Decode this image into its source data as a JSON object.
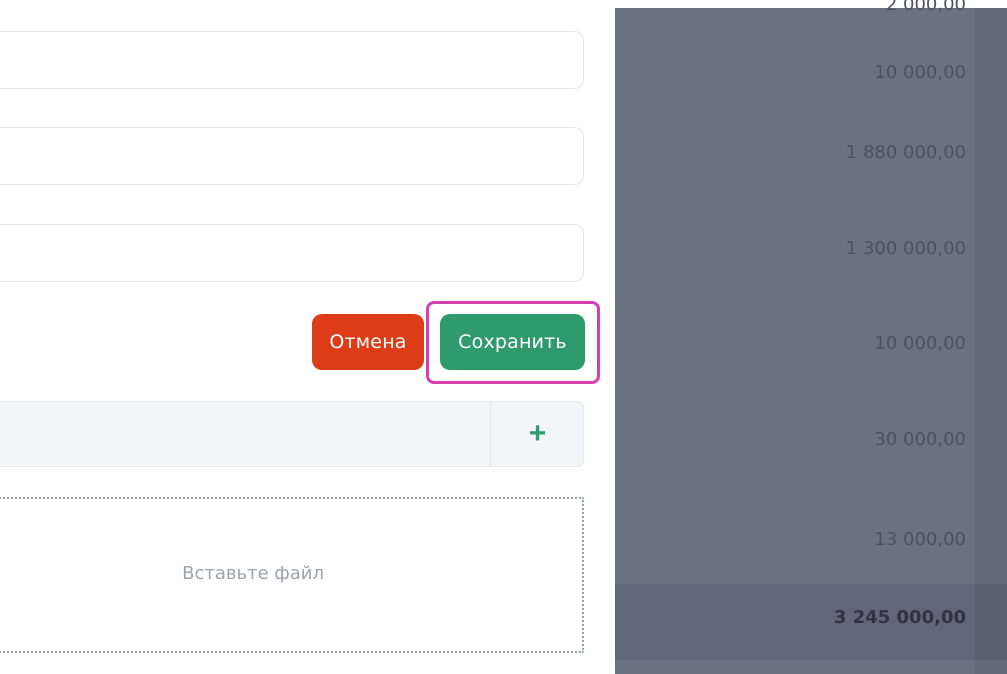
{
  "form": {
    "fields": [
      {
        "value": "",
        "placeholder": ""
      },
      {
        "value": "",
        "placeholder": ""
      },
      {
        "value": "",
        "placeholder": ""
      }
    ],
    "cancel_label": "Отмена",
    "save_label": "Сохранить",
    "add_label": "+",
    "dropzone_label": "Вставьте файл"
  },
  "amounts": {
    "partial_top": "2 000,00",
    "rows": [
      "10 000,00",
      "1 880 000,00",
      "1 300 000,00",
      "10 000,00",
      "30 000,00",
      "13 000,00"
    ],
    "total": "3 245 000,00"
  },
  "colors": {
    "cancel": "#dc3d18",
    "save": "#2f9a6b",
    "highlight": "#d63fb2",
    "side_panel": "#6a7282"
  },
  "icons": {
    "add": "plus-icon"
  }
}
